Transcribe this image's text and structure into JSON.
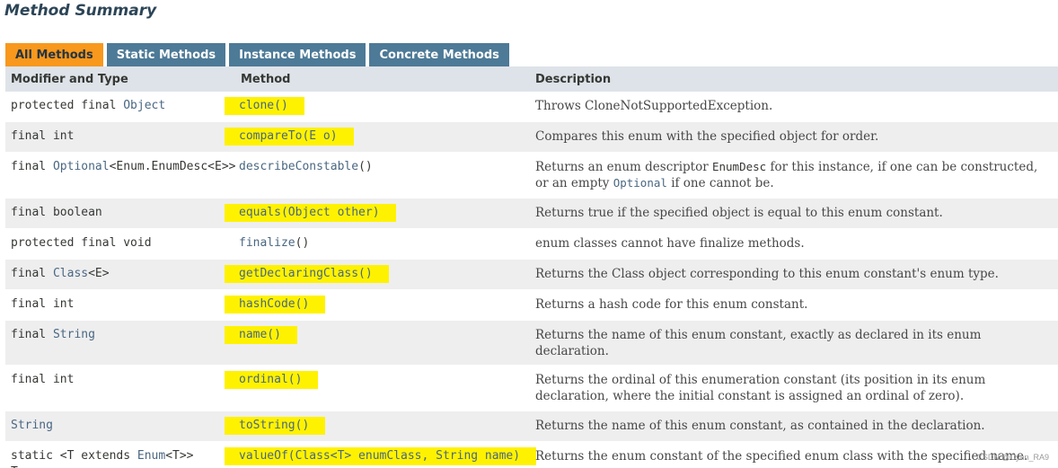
{
  "section_title": "Method Summary",
  "tabs": [
    {
      "label": "All Methods",
      "active": true
    },
    {
      "label": "Static Methods",
      "active": false
    },
    {
      "label": "Instance Methods",
      "active": false
    },
    {
      "label": "Concrete Methods",
      "active": false
    }
  ],
  "table": {
    "headers": {
      "modifier": "Modifier and Type",
      "method": "Method",
      "description": "Description"
    },
    "rows": [
      {
        "modifier_prefix": "protected final ",
        "modifier_type": "Object",
        "modifier_suffix": "",
        "method": "clone()",
        "highlighted": true,
        "description": "Throws CloneNotSupportedException."
      },
      {
        "modifier_prefix": "final int",
        "modifier_type": "",
        "modifier_suffix": "",
        "method": "compareTo(E o)",
        "highlighted": true,
        "description": "Compares this enum with the specified object for order."
      },
      {
        "modifier_prefix": "final ",
        "modifier_type": "Optional",
        "modifier_suffix": "<Enum.EnumDesc<E>>",
        "method_name": "describeConstable",
        "method_args": "()",
        "highlighted": false,
        "description_part1": "Returns an enum descriptor ",
        "description_code1": "EnumDesc",
        "description_part2": " for this instance, if one can be constructed, or an empty ",
        "description_code2": "Optional",
        "description_part3": " if one cannot be."
      },
      {
        "modifier_prefix": "final boolean",
        "modifier_type": "",
        "modifier_suffix": "",
        "method": "equals(Object other)",
        "highlighted": true,
        "description": "Returns true if the specified object is equal to this enum constant."
      },
      {
        "modifier_prefix": "protected final void",
        "modifier_type": "",
        "modifier_suffix": "",
        "method_name": "finalize",
        "method_args": "()",
        "highlighted": false,
        "description": "enum classes cannot have finalize methods."
      },
      {
        "modifier_prefix": "final ",
        "modifier_type": "Class",
        "modifier_suffix": "<E>",
        "method": "getDeclaringClass()",
        "highlighted": true,
        "description": "Returns the Class object corresponding to this enum constant's enum type."
      },
      {
        "modifier_prefix": "final int",
        "modifier_type": "",
        "modifier_suffix": "",
        "method": "hashCode()",
        "highlighted": true,
        "description": "Returns a hash code for this enum constant."
      },
      {
        "modifier_prefix": "final ",
        "modifier_type": "String",
        "modifier_suffix": "",
        "method": "name()",
        "highlighted": true,
        "description": "Returns the name of this enum constant, exactly as declared in its enum declaration."
      },
      {
        "modifier_prefix": "final int",
        "modifier_type": "",
        "modifier_suffix": "",
        "method": "ordinal()",
        "highlighted": true,
        "description": "Returns the ordinal of this enumeration constant (its position in its enum declaration, where the initial constant is assigned an ordinal of zero)."
      },
      {
        "modifier_prefix": "",
        "modifier_type": "String",
        "modifier_suffix": "",
        "method": "toString()",
        "highlighted": true,
        "description": "Returns the name of this enum constant, as contained in the declaration."
      },
      {
        "modifier_prefix": "static <T extends ",
        "modifier_type": "Enum",
        "modifier_suffix": "<T>>",
        "modifier_line2": "T",
        "method": "valueOf(Class<T> enumClass, String name)",
        "highlighted": true,
        "description": "Returns the enum constant of the specified enum class with the specified name."
      }
    ]
  },
  "watermark": "CSDN @Cyan_RA9",
  "colors": {
    "active_tab": "#f8981d",
    "inactive_tab": "#4d7a97",
    "header_bg": "#dee3e9",
    "alt_row_bg": "#eeeeef",
    "highlight": "#fff200",
    "link": "#4a6782"
  }
}
